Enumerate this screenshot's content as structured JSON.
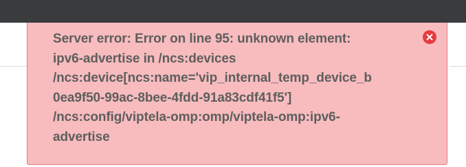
{
  "error_toast": {
    "message": "Server error: Error on line 95: unknown element:\nipv6-advertise in /ncs:devices\n/ncs:device[ncs:name='vip_internal_temp_device_b\n0ea9f50-99ac-8bee-4fdd-91a83cdf41f5']\n/ncs:config/viptela-omp:omp/viptela-omp:ipv6-\nadvertise",
    "close_icon": "close-icon",
    "background_color": "#f8bcbe",
    "border_color": "#e3787f",
    "close_color": "#e63a3f"
  },
  "header": {
    "background_color": "#3a3b3d"
  }
}
